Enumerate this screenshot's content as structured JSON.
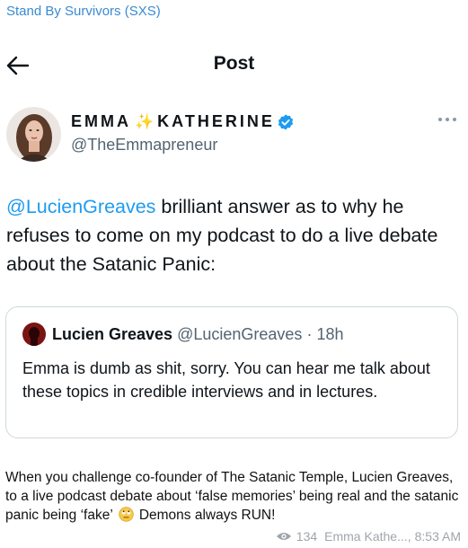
{
  "channel": {
    "name": "Stand By Survivors (SXS)"
  },
  "header": {
    "title": "Post"
  },
  "author": {
    "name_part1": "EMMA",
    "sparkle": "✨",
    "name_part2": "KATHERINE",
    "handle": "@TheEmmapreneur"
  },
  "tweet": {
    "mention": "@LucienGreaves",
    "text": " brilliant answer as to why he refuses to come on my podcast to do a live debate about the Satanic Panic:"
  },
  "quote": {
    "name": "Lucien Greaves",
    "handle": "@LucienGreaves",
    "sep": " · ",
    "time": "18h",
    "text": "Emma is dumb as shit, sorry. You can hear me talk about these topics in credible interviews and in lectures."
  },
  "caption": {
    "text_before": "When you challenge co-founder of The Satanic Temple, Lucien Greaves, to a live podcast debate about ‘false memories’ being real and the satanic panic being ‘fake’ ",
    "emoji": "eye-roll-emoji",
    "text_after": " Demons always RUN!"
  },
  "footer": {
    "views": "134",
    "author": "Emma Kathe...,",
    "time": "8:53 AM"
  },
  "colors": {
    "accent": "#1d9bf0",
    "channel": "#3a8ad1",
    "muted": "#536471"
  }
}
